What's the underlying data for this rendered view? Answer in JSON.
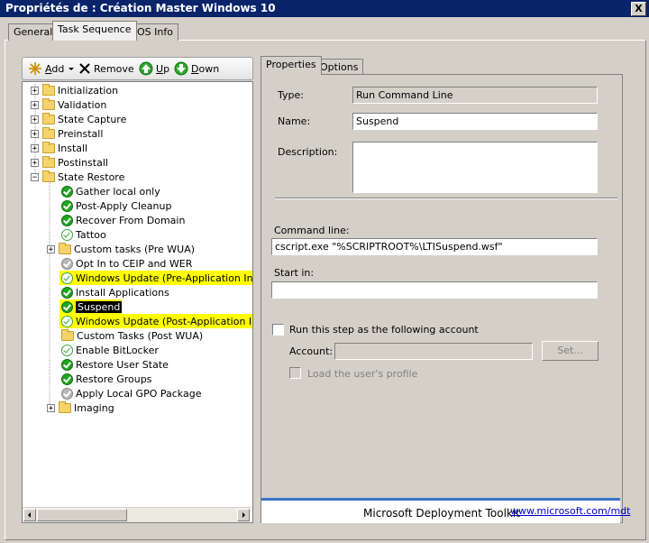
{
  "window": {
    "title": "Propriétés de : Création Master Windows 10",
    "close_glyph": "X"
  },
  "tabs": [
    {
      "label": "General",
      "active": false
    },
    {
      "label": "Task Sequence",
      "active": true
    },
    {
      "label": "OS Info",
      "active": false
    }
  ],
  "toolbar": {
    "add": "Add",
    "add_underline": "A",
    "add_rest": "dd",
    "remove": "Remove",
    "up": "Up",
    "up_underline": "U",
    "up_rest": "p",
    "down": "Down",
    "down_underline": "D",
    "down_rest": "own"
  },
  "tree": {
    "groups": [
      {
        "label": "Initialization"
      },
      {
        "label": "Validation"
      },
      {
        "label": "State Capture"
      },
      {
        "label": "Preinstall"
      },
      {
        "label": "Install"
      },
      {
        "label": "Postinstall"
      },
      {
        "label": "State Restore"
      }
    ],
    "state_restore_children": [
      {
        "label": "Gather local only",
        "status": "green"
      },
      {
        "label": "Post-Apply Cleanup",
        "status": "green"
      },
      {
        "label": "Recover From Domain",
        "status": "green"
      },
      {
        "label": "Tattoo",
        "status": "outline"
      },
      {
        "label": "Custom tasks (Pre WUA)",
        "status": "folder"
      },
      {
        "label": "Opt In to CEIP and WER",
        "status": "gray"
      },
      {
        "label": "Windows Update (Pre-Application Installa",
        "status": "outline",
        "highlight": "yellow"
      },
      {
        "label": "Install Applications",
        "status": "green"
      },
      {
        "label": "Suspend",
        "status": "green",
        "highlight": "selected"
      },
      {
        "label": "Windows Update (Post-Application Install",
        "status": "outline",
        "highlight": "yellow"
      },
      {
        "label": "Custom Tasks (Post WUA)",
        "status": "folder"
      },
      {
        "label": "Enable BitLocker",
        "status": "outline"
      },
      {
        "label": "Restore User State",
        "status": "green"
      },
      {
        "label": "Restore Groups",
        "status": "green"
      },
      {
        "label": "Apply Local GPO Package",
        "status": "gray"
      },
      {
        "label": "Imaging",
        "status": "folder"
      }
    ]
  },
  "props_tabs": [
    {
      "label": "Properties",
      "active": true
    },
    {
      "label": "Options",
      "active": false
    }
  ],
  "properties": {
    "type_label": "Type:",
    "type_value": "Run Command Line",
    "name_label": "Name:",
    "name_value": "Suspend",
    "description_label": "Description:",
    "description_value": "",
    "command_line_label": "Command line:",
    "command_line_value": "cscript.exe \"%SCRIPTROOT%\\LTISuspend.wsf\"",
    "start_in_label": "Start in:",
    "start_in_value": "",
    "run_as_label": "Run this step as the following account",
    "account_label": "Account:",
    "account_value": "",
    "set_button": "Set...",
    "load_profile_label": "Load the user's profile"
  },
  "footer": {
    "brand": "Microsoft Deployment Toolkit",
    "link": "www.microsoft.com/mdt"
  },
  "colors": {
    "title_bar": "#0a246a",
    "highlight_yellow": "#ffff00",
    "footer_accent": "#3a74c7"
  }
}
